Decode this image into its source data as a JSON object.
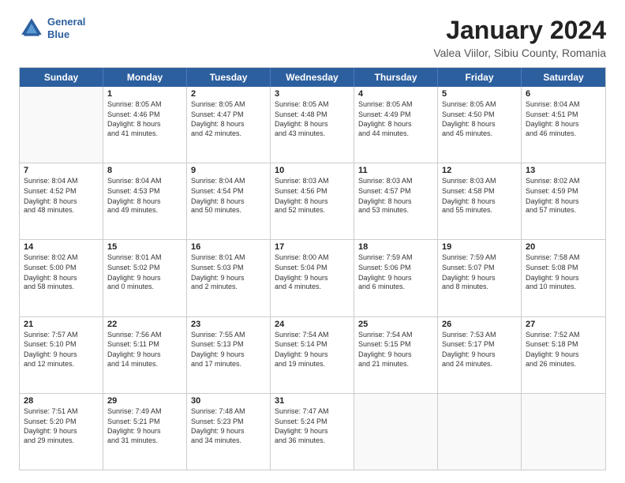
{
  "header": {
    "logo_line1": "General",
    "logo_line2": "Blue",
    "title": "January 2024",
    "subtitle": "Valea Viilor, Sibiu County, Romania"
  },
  "weekdays": [
    "Sunday",
    "Monday",
    "Tuesday",
    "Wednesday",
    "Thursday",
    "Friday",
    "Saturday"
  ],
  "rows": [
    [
      {
        "day": "",
        "sunrise": "",
        "sunset": "",
        "daylight": ""
      },
      {
        "day": "1",
        "sunrise": "Sunrise: 8:05 AM",
        "sunset": "Sunset: 4:46 PM",
        "daylight": "Daylight: 8 hours and 41 minutes."
      },
      {
        "day": "2",
        "sunrise": "Sunrise: 8:05 AM",
        "sunset": "Sunset: 4:47 PM",
        "daylight": "Daylight: 8 hours and 42 minutes."
      },
      {
        "day": "3",
        "sunrise": "Sunrise: 8:05 AM",
        "sunset": "Sunset: 4:48 PM",
        "daylight": "Daylight: 8 hours and 43 minutes."
      },
      {
        "day": "4",
        "sunrise": "Sunrise: 8:05 AM",
        "sunset": "Sunset: 4:49 PM",
        "daylight": "Daylight: 8 hours and 44 minutes."
      },
      {
        "day": "5",
        "sunrise": "Sunrise: 8:05 AM",
        "sunset": "Sunset: 4:50 PM",
        "daylight": "Daylight: 8 hours and 45 minutes."
      },
      {
        "day": "6",
        "sunrise": "Sunrise: 8:04 AM",
        "sunset": "Sunset: 4:51 PM",
        "daylight": "Daylight: 8 hours and 46 minutes."
      }
    ],
    [
      {
        "day": "7",
        "sunrise": "Sunrise: 8:04 AM",
        "sunset": "Sunset: 4:52 PM",
        "daylight": "Daylight: 8 hours and 48 minutes."
      },
      {
        "day": "8",
        "sunrise": "Sunrise: 8:04 AM",
        "sunset": "Sunset: 4:53 PM",
        "daylight": "Daylight: 8 hours and 49 minutes."
      },
      {
        "day": "9",
        "sunrise": "Sunrise: 8:04 AM",
        "sunset": "Sunset: 4:54 PM",
        "daylight": "Daylight: 8 hours and 50 minutes."
      },
      {
        "day": "10",
        "sunrise": "Sunrise: 8:03 AM",
        "sunset": "Sunset: 4:56 PM",
        "daylight": "Daylight: 8 hours and 52 minutes."
      },
      {
        "day": "11",
        "sunrise": "Sunrise: 8:03 AM",
        "sunset": "Sunset: 4:57 PM",
        "daylight": "Daylight: 8 hours and 53 minutes."
      },
      {
        "day": "12",
        "sunrise": "Sunrise: 8:03 AM",
        "sunset": "Sunset: 4:58 PM",
        "daylight": "Daylight: 8 hours and 55 minutes."
      },
      {
        "day": "13",
        "sunrise": "Sunrise: 8:02 AM",
        "sunset": "Sunset: 4:59 PM",
        "daylight": "Daylight: 8 hours and 57 minutes."
      }
    ],
    [
      {
        "day": "14",
        "sunrise": "Sunrise: 8:02 AM",
        "sunset": "Sunset: 5:00 PM",
        "daylight": "Daylight: 8 hours and 58 minutes."
      },
      {
        "day": "15",
        "sunrise": "Sunrise: 8:01 AM",
        "sunset": "Sunset: 5:02 PM",
        "daylight": "Daylight: 9 hours and 0 minutes."
      },
      {
        "day": "16",
        "sunrise": "Sunrise: 8:01 AM",
        "sunset": "Sunset: 5:03 PM",
        "daylight": "Daylight: 9 hours and 2 minutes."
      },
      {
        "day": "17",
        "sunrise": "Sunrise: 8:00 AM",
        "sunset": "Sunset: 5:04 PM",
        "daylight": "Daylight: 9 hours and 4 minutes."
      },
      {
        "day": "18",
        "sunrise": "Sunrise: 7:59 AM",
        "sunset": "Sunset: 5:06 PM",
        "daylight": "Daylight: 9 hours and 6 minutes."
      },
      {
        "day": "19",
        "sunrise": "Sunrise: 7:59 AM",
        "sunset": "Sunset: 5:07 PM",
        "daylight": "Daylight: 9 hours and 8 minutes."
      },
      {
        "day": "20",
        "sunrise": "Sunrise: 7:58 AM",
        "sunset": "Sunset: 5:08 PM",
        "daylight": "Daylight: 9 hours and 10 minutes."
      }
    ],
    [
      {
        "day": "21",
        "sunrise": "Sunrise: 7:57 AM",
        "sunset": "Sunset: 5:10 PM",
        "daylight": "Daylight: 9 hours and 12 minutes."
      },
      {
        "day": "22",
        "sunrise": "Sunrise: 7:56 AM",
        "sunset": "Sunset: 5:11 PM",
        "daylight": "Daylight: 9 hours and 14 minutes."
      },
      {
        "day": "23",
        "sunrise": "Sunrise: 7:55 AM",
        "sunset": "Sunset: 5:13 PM",
        "daylight": "Daylight: 9 hours and 17 minutes."
      },
      {
        "day": "24",
        "sunrise": "Sunrise: 7:54 AM",
        "sunset": "Sunset: 5:14 PM",
        "daylight": "Daylight: 9 hours and 19 minutes."
      },
      {
        "day": "25",
        "sunrise": "Sunrise: 7:54 AM",
        "sunset": "Sunset: 5:15 PM",
        "daylight": "Daylight: 9 hours and 21 minutes."
      },
      {
        "day": "26",
        "sunrise": "Sunrise: 7:53 AM",
        "sunset": "Sunset: 5:17 PM",
        "daylight": "Daylight: 9 hours and 24 minutes."
      },
      {
        "day": "27",
        "sunrise": "Sunrise: 7:52 AM",
        "sunset": "Sunset: 5:18 PM",
        "daylight": "Daylight: 9 hours and 26 minutes."
      }
    ],
    [
      {
        "day": "28",
        "sunrise": "Sunrise: 7:51 AM",
        "sunset": "Sunset: 5:20 PM",
        "daylight": "Daylight: 9 hours and 29 minutes."
      },
      {
        "day": "29",
        "sunrise": "Sunrise: 7:49 AM",
        "sunset": "Sunset: 5:21 PM",
        "daylight": "Daylight: 9 hours and 31 minutes."
      },
      {
        "day": "30",
        "sunrise": "Sunrise: 7:48 AM",
        "sunset": "Sunset: 5:23 PM",
        "daylight": "Daylight: 9 hours and 34 minutes."
      },
      {
        "day": "31",
        "sunrise": "Sunrise: 7:47 AM",
        "sunset": "Sunset: 5:24 PM",
        "daylight": "Daylight: 9 hours and 36 minutes."
      },
      {
        "day": "",
        "sunrise": "",
        "sunset": "",
        "daylight": ""
      },
      {
        "day": "",
        "sunrise": "",
        "sunset": "",
        "daylight": ""
      },
      {
        "day": "",
        "sunrise": "",
        "sunset": "",
        "daylight": ""
      }
    ]
  ]
}
